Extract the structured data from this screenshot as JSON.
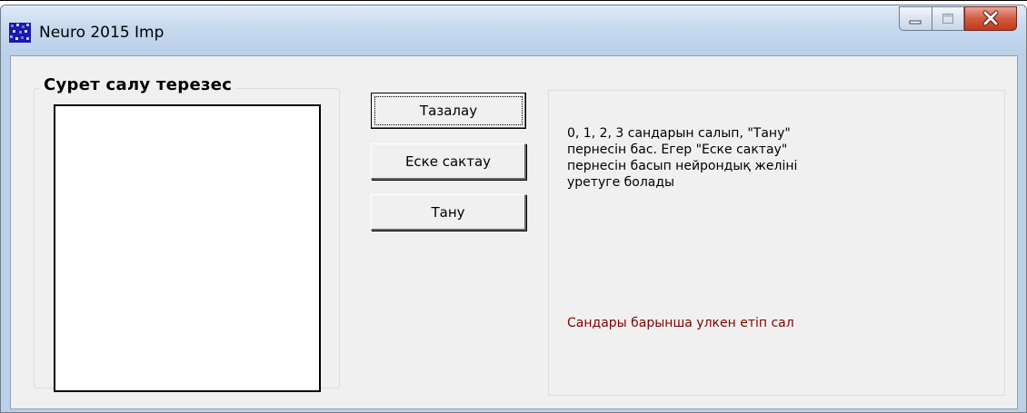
{
  "window": {
    "title": "Neuro 2015 Imp",
    "controls": {
      "minimize_icon": "minimize-icon",
      "maximize_icon": "maximize-icon",
      "close_icon": "close-icon"
    }
  },
  "drawing_group": {
    "title": "Сурет салу терезес"
  },
  "buttons": {
    "clear_label": "Тазалау",
    "remember_label": "Еске сактау",
    "recognize_label": "Тану"
  },
  "info_panel": {
    "instructions": " 0, 1, 2, 3 сандарын салып, \"Тану\"\nпернесін бас. Егер  \"Еске сактау\"\nпернесін басып нейрондық желіні\nуретуге болады",
    "hint": "Сандары барынша улкен етіп сал"
  },
  "colors": {
    "window_frame": "#bcd1e8",
    "client_bg": "#f0f0f0",
    "close_button": "#c94a2f",
    "hint_text": "#800000"
  }
}
